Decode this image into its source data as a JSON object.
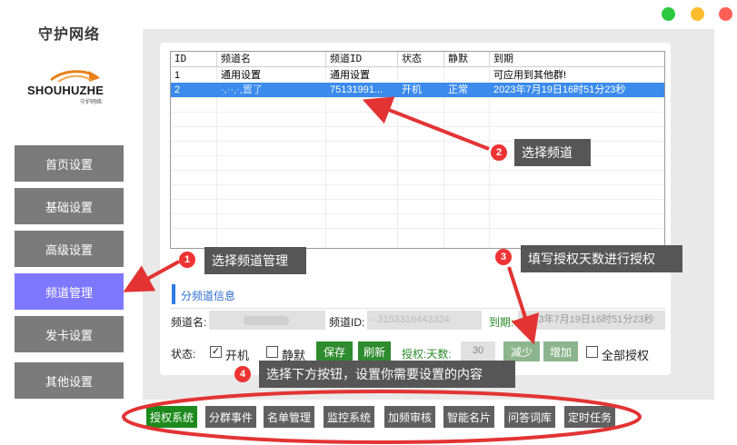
{
  "app": {
    "title": "守护网络",
    "logo_text": "SHOUHUZHE",
    "logo_sub": "守护网络"
  },
  "window_controls": {
    "colors": [
      "#2bc840",
      "#fdbc2e",
      "#fe5f57"
    ]
  },
  "sidebar": {
    "items": [
      {
        "label": "首页设置"
      },
      {
        "label": "基础设置"
      },
      {
        "label": "高级设置"
      },
      {
        "label": "频道管理",
        "active": true
      },
      {
        "label": "发卡设置"
      },
      {
        "label": "其他设置"
      }
    ]
  },
  "table": {
    "columns": [
      "ID",
      "频道名",
      "频道ID",
      "状态",
      "静默",
      "到期"
    ],
    "rows": [
      {
        "id": "1",
        "name": "通用设置",
        "channel_id": "通用设置",
        "status": "",
        "silent": "",
        "expiry": "可应用到其他群!"
      },
      {
        "id": "2",
        "name": "·,··,·,置了",
        "channel_id": "75131991...",
        "status": "开机",
        "silent": "正常",
        "expiry": "2023年7月19日16时51分23秒",
        "selected": true
      }
    ]
  },
  "section": {
    "title": "分频道信息"
  },
  "form": {
    "channel_name_label": "频道名:",
    "channel_id_label": "频道ID:",
    "channel_id_value": "··3153316443324·",
    "expiry_label": "到期:",
    "expiry_value": "2023年7月19日16时51分23秒",
    "status_label": "状态:",
    "power_on_label": "开机",
    "power_on_checked": true,
    "silent_label": "静默",
    "silent_checked": false,
    "save_label": "保存",
    "refresh_label": "刷新",
    "auth_label": "授权:天数:",
    "days_value": "30",
    "decrease_label": "减少",
    "increase_label": "增加",
    "auth_all_label": "全部授权",
    "auth_all_checked": false
  },
  "bottom_tabs": [
    {
      "label": "授权系统",
      "active": true
    },
    {
      "label": "分群事件"
    },
    {
      "label": "名单管理"
    },
    {
      "label": "监控系统"
    },
    {
      "label": "加频审核"
    },
    {
      "label": "智能名片"
    },
    {
      "label": "问答词库"
    },
    {
      "label": "定时任务"
    }
  ],
  "callouts": [
    {
      "number": "1",
      "text": "选择频道管理"
    },
    {
      "number": "2",
      "text": "选择频道"
    },
    {
      "number": "3",
      "text": "填写授权天数进行授权"
    },
    {
      "number": "4",
      "text": "选择下方按钮，设置你需要设置的内容"
    }
  ],
  "colors": {
    "accent": "#7e78ff",
    "select": "#3b8bec",
    "green": "#2e8b2e",
    "annotation_red": "#e33333"
  }
}
